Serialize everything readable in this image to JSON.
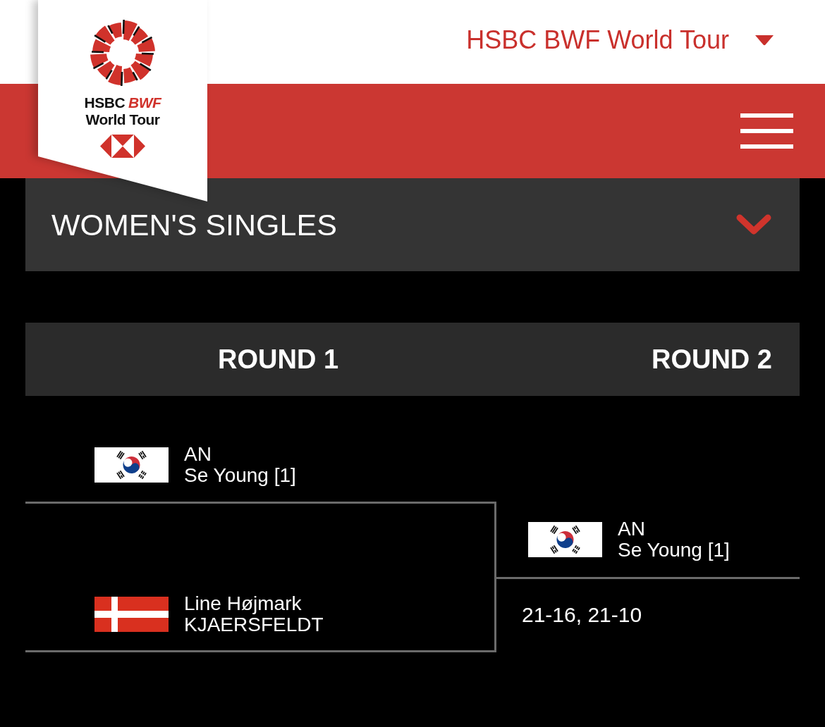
{
  "header": {
    "logo": {
      "brand": "HSBC",
      "brand_accent": "BWF",
      "tagline": "World Tour"
    },
    "tour_menu": {
      "label": "HSBC BWF World Tour"
    }
  },
  "event_selector": {
    "label": "WOMEN'S SINGLES",
    "expanded": false
  },
  "draw": {
    "rounds": [
      {
        "title": "ROUND 1",
        "matches": [
          {
            "players": [
              {
                "flag": {
                  "kind": "korea"
                },
                "name_line_1": "AN",
                "name_line_2": "Se Young [1]"
              },
              {
                "flag": {
                  "kind": "denmark"
                },
                "name_line_1": "Line Højmark",
                "name_line_2": "KJAERSFELDT"
              }
            ]
          }
        ]
      },
      {
        "title": "ROUND 2",
        "matches": [
          {
            "players": [
              {
                "flag": {
                  "kind": "korea"
                },
                "name_line_1": "AN",
                "name_line_2": "Se Young [1]"
              }
            ],
            "score": "21-16, 21-10"
          }
        ]
      }
    ]
  }
}
